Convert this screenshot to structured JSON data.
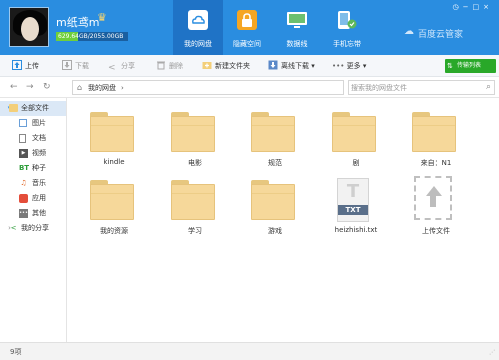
{
  "header": {
    "username": "m纸鸢m",
    "quota_text": "629.64GB/2055.00GB",
    "quota_fraction": 0.306,
    "brand": "百度云管家",
    "nav": [
      {
        "label": "我的网盘",
        "icon": "cloud-drive-icon",
        "active": true
      },
      {
        "label": "隐藏空间",
        "icon": "lock-icon",
        "active": false
      },
      {
        "label": "数据线",
        "icon": "data-cable-icon",
        "active": false
      },
      {
        "label": "手机忘带",
        "icon": "phone-remote-icon",
        "active": false
      }
    ]
  },
  "toolbar": {
    "upload": "上传",
    "download": "下载",
    "share": "分享",
    "delete": "删除",
    "new_folder": "新建文件夹",
    "offline_download": "离线下载",
    "more": "更多",
    "transfer_list": "传输列表"
  },
  "address": {
    "path": "我的网盘",
    "search_placeholder": "搜索我的网盘文件"
  },
  "sidebar": {
    "items": [
      {
        "label": "全部文件",
        "icon": "folder-icon"
      },
      {
        "label": "图片",
        "icon": "image-icon"
      },
      {
        "label": "文档",
        "icon": "document-icon"
      },
      {
        "label": "视频",
        "icon": "video-icon"
      },
      {
        "label": "种子",
        "icon": "bt-torrent-icon",
        "badge": "BT"
      },
      {
        "label": "音乐",
        "icon": "music-icon"
      },
      {
        "label": "应用",
        "icon": "app-icon"
      },
      {
        "label": "其他",
        "icon": "other-icon"
      },
      {
        "label": "我的分享",
        "icon": "share-icon"
      }
    ]
  },
  "files": [
    {
      "name": "kindle",
      "kind": "folder"
    },
    {
      "name": "电影",
      "kind": "folder"
    },
    {
      "name": "规范",
      "kind": "folder"
    },
    {
      "name": "剧",
      "kind": "folder"
    },
    {
      "name": "来自：N1",
      "kind": "folder"
    },
    {
      "name": "我的资源",
      "kind": "folder"
    },
    {
      "name": "学习",
      "kind": "folder"
    },
    {
      "name": "游戏",
      "kind": "folder"
    },
    {
      "name": "heizhishi.txt",
      "kind": "txt",
      "badge": "TXT"
    },
    {
      "name": "上传文件",
      "kind": "upload"
    }
  ],
  "status": {
    "count": "9项"
  },
  "colors": {
    "header_bg": "#2a8de0",
    "active_tab": "#1f73c6",
    "transfer_btn": "#29a829",
    "quota_fill": "#6fcf3a"
  }
}
